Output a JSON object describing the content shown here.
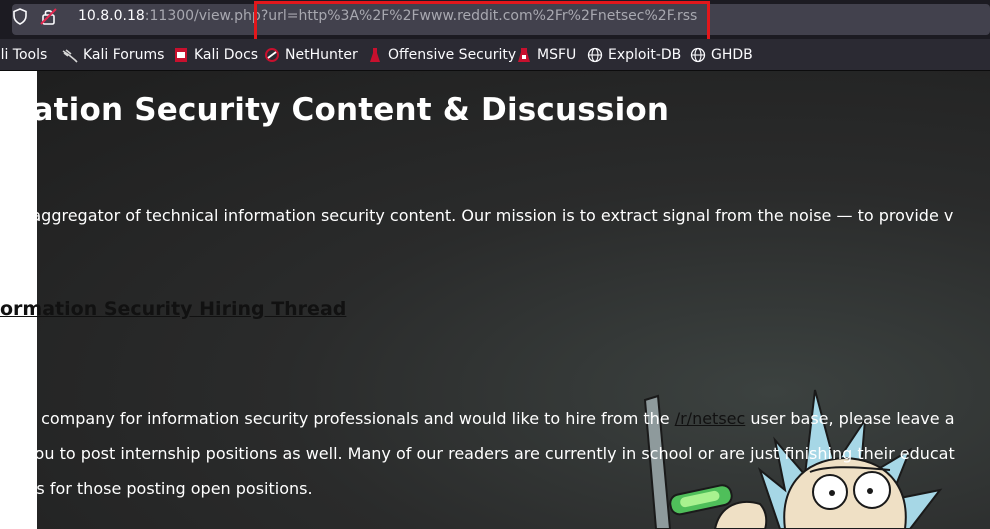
{
  "browser": {
    "url_host": "10.8.0.18",
    "url_port_path": ":11300/view.php",
    "url_query": "?url=http%3A%2F%2Fwww.reddit.com%2Fr%2Fnetsec%2F.rss",
    "highlight_color": "#e3171b"
  },
  "bookmarks": [
    {
      "label": "ali Tools",
      "icon": "kali-icon"
    },
    {
      "label": "Kali Forums",
      "icon": "kali-dragon-icon"
    },
    {
      "label": "Kali Docs",
      "icon": "kali-docs-icon"
    },
    {
      "label": "NetHunter",
      "icon": "nethunter-icon"
    },
    {
      "label": "Offensive Security",
      "icon": "offsec-icon"
    },
    {
      "label": "MSFU",
      "icon": "msfu-icon"
    },
    {
      "label": "Exploit-DB",
      "icon": "globe-icon"
    },
    {
      "label": "GHDB",
      "icon": "globe-icon"
    }
  ],
  "page": {
    "title": "mation Security Content & Discussion",
    "intro": "ted aggregator of technical information security content. Our mission is to extract signal from the noise — to provide v",
    "hiring_heading": "ormation Security Hiring Thread",
    "hiring_line1_a": "your company for information security professionals and would like to hire from the ",
    "hiring_line1_a_prefix": "",
    "hiring_line1_link": "/r/netsec",
    "hiring_line1_b": " user base, please leave a",
    "hiring_line2": "ge you to post internship positions as well. Many of our readers are currently in school or are just finishing their educat",
    "hiring_line3": "nents for those posting open positions."
  }
}
